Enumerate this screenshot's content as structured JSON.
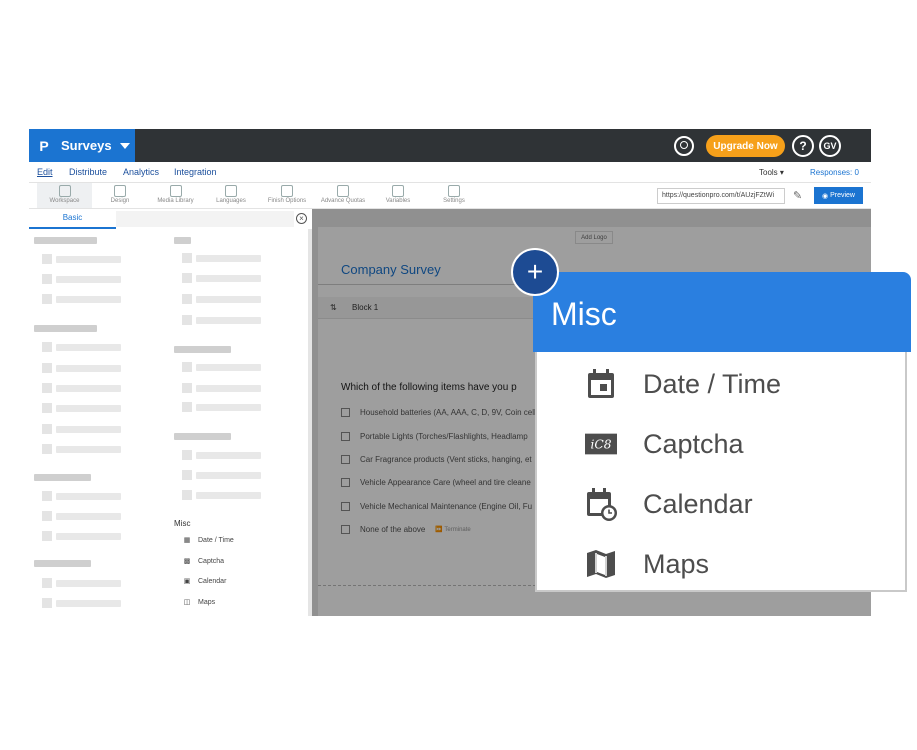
{
  "topbar": {
    "brand_logo": "P",
    "brand_name": "Surveys",
    "upgrade_label": "Upgrade Now",
    "help_label": "?",
    "avatar_initials": "GV"
  },
  "nav": {
    "tabs": [
      "Edit",
      "Distribute",
      "Analytics",
      "Integration"
    ],
    "tools_label": "Tools",
    "responses_label": "Responses: 0"
  },
  "toolbar": {
    "items": [
      "Workspace",
      "Design",
      "Media Library",
      "Languages",
      "Finish Options",
      "Advance Quotas",
      "Variables",
      "Settings"
    ],
    "url": "https://questionpro.com/t/AUzjFZtWi",
    "preview_label": "Preview"
  },
  "leftpanel": {
    "tab_basic": "Basic",
    "misc_title": "Misc",
    "misc_items": [
      "Date / Time",
      "Captcha",
      "Calendar",
      "Maps"
    ]
  },
  "canvas": {
    "add_logo": "Add Logo",
    "survey_title": "Company Survey",
    "block_label": "Block 1",
    "question": "Which of the following items have you p",
    "options": [
      "Household batteries (AA, AAA, C, D, 9V, Coin cell",
      "Portable Lights (Torches/Flashlights, Headlamp",
      "Car Fragrance products (Vent sticks, hanging, et",
      "Vehicle Appearance Care (wheel and tire cleane",
      "Vehicle Mechanical Maintenance (Engine Oil, Fu",
      "None of the above"
    ],
    "terminate_label": "Terminate"
  },
  "popup": {
    "title": "Misc",
    "items": [
      {
        "label": "Date / Time",
        "icon": "date-time-icon"
      },
      {
        "label": "Captcha",
        "icon": "captcha-icon"
      },
      {
        "label": "Calendar",
        "icon": "calendar-icon"
      },
      {
        "label": "Maps",
        "icon": "map-icon"
      }
    ]
  },
  "colors": {
    "brand": "#1b74d1",
    "topbar": "#2f3336",
    "upgrade": "#f6a01a",
    "popup_header": "#2a7fe0",
    "plus_button": "#1d4b93"
  }
}
